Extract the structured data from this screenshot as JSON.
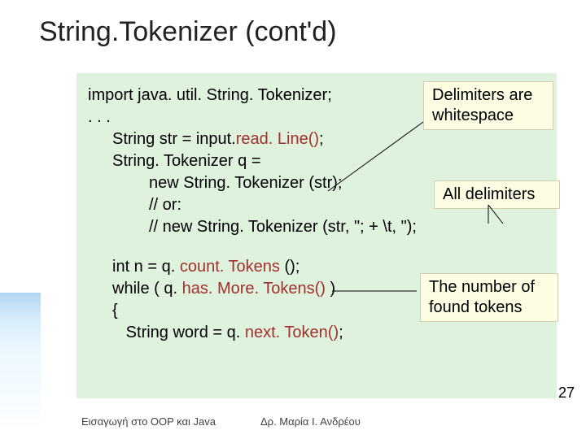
{
  "title": "String.Tokenizer (cont'd)",
  "code": {
    "l1": "import java. util. String. Tokenizer;",
    "l2": ". . .",
    "l3a": "String str = input.",
    "l3b": "read. Line()",
    "l3c": ";",
    "l4": "String. Tokenizer q =",
    "l5": "new String. Tokenizer (str);",
    "l6": "// or:",
    "l7": "//   new String. Tokenizer (str, \"; + \\t, \");",
    "l8a": "int n = q.",
    "l8b": " count. Tokens",
    "l8c": " ();",
    "l9a": "while ( q.",
    "l9b": " has. More. Tokens()",
    "l9c": " )",
    "l10": "{",
    "l11a": "String word = q.",
    "l11b": " next. Token()",
    "l11c": ";"
  },
  "callouts": {
    "delimiters_ws": "Delimiters are whitespace",
    "all_delims": "All delimiters",
    "found_tokens": "The number of found tokens"
  },
  "footer": {
    "left": "Εισαγωγή στο OOP και Java",
    "center": "Δρ. Μαρία Ι. Ανδρέου"
  },
  "page_number": "27"
}
